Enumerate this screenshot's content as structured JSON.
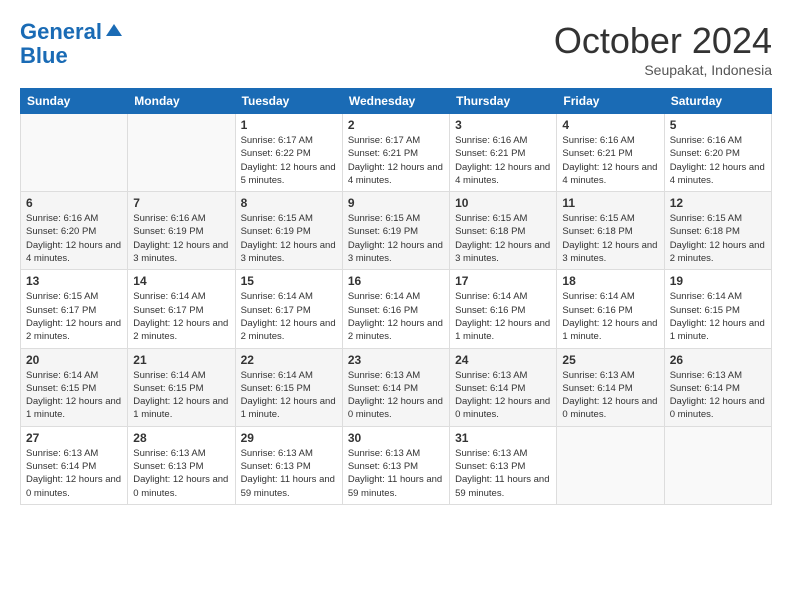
{
  "header": {
    "logo_line1": "General",
    "logo_line2": "Blue",
    "month_title": "October 2024",
    "subtitle": "Seupakat, Indonesia"
  },
  "weekdays": [
    "Sunday",
    "Monday",
    "Tuesday",
    "Wednesday",
    "Thursday",
    "Friday",
    "Saturday"
  ],
  "weeks": [
    [
      {
        "day": "",
        "sunrise": "",
        "sunset": "",
        "daylight": ""
      },
      {
        "day": "",
        "sunrise": "",
        "sunset": "",
        "daylight": ""
      },
      {
        "day": "1",
        "sunrise": "Sunrise: 6:17 AM",
        "sunset": "Sunset: 6:22 PM",
        "daylight": "Daylight: 12 hours and 5 minutes."
      },
      {
        "day": "2",
        "sunrise": "Sunrise: 6:17 AM",
        "sunset": "Sunset: 6:21 PM",
        "daylight": "Daylight: 12 hours and 4 minutes."
      },
      {
        "day": "3",
        "sunrise": "Sunrise: 6:16 AM",
        "sunset": "Sunset: 6:21 PM",
        "daylight": "Daylight: 12 hours and 4 minutes."
      },
      {
        "day": "4",
        "sunrise": "Sunrise: 6:16 AM",
        "sunset": "Sunset: 6:21 PM",
        "daylight": "Daylight: 12 hours and 4 minutes."
      },
      {
        "day": "5",
        "sunrise": "Sunrise: 6:16 AM",
        "sunset": "Sunset: 6:20 PM",
        "daylight": "Daylight: 12 hours and 4 minutes."
      }
    ],
    [
      {
        "day": "6",
        "sunrise": "Sunrise: 6:16 AM",
        "sunset": "Sunset: 6:20 PM",
        "daylight": "Daylight: 12 hours and 4 minutes."
      },
      {
        "day": "7",
        "sunrise": "Sunrise: 6:16 AM",
        "sunset": "Sunset: 6:19 PM",
        "daylight": "Daylight: 12 hours and 3 minutes."
      },
      {
        "day": "8",
        "sunrise": "Sunrise: 6:15 AM",
        "sunset": "Sunset: 6:19 PM",
        "daylight": "Daylight: 12 hours and 3 minutes."
      },
      {
        "day": "9",
        "sunrise": "Sunrise: 6:15 AM",
        "sunset": "Sunset: 6:19 PM",
        "daylight": "Daylight: 12 hours and 3 minutes."
      },
      {
        "day": "10",
        "sunrise": "Sunrise: 6:15 AM",
        "sunset": "Sunset: 6:18 PM",
        "daylight": "Daylight: 12 hours and 3 minutes."
      },
      {
        "day": "11",
        "sunrise": "Sunrise: 6:15 AM",
        "sunset": "Sunset: 6:18 PM",
        "daylight": "Daylight: 12 hours and 3 minutes."
      },
      {
        "day": "12",
        "sunrise": "Sunrise: 6:15 AM",
        "sunset": "Sunset: 6:18 PM",
        "daylight": "Daylight: 12 hours and 2 minutes."
      }
    ],
    [
      {
        "day": "13",
        "sunrise": "Sunrise: 6:15 AM",
        "sunset": "Sunset: 6:17 PM",
        "daylight": "Daylight: 12 hours and 2 minutes."
      },
      {
        "day": "14",
        "sunrise": "Sunrise: 6:14 AM",
        "sunset": "Sunset: 6:17 PM",
        "daylight": "Daylight: 12 hours and 2 minutes."
      },
      {
        "day": "15",
        "sunrise": "Sunrise: 6:14 AM",
        "sunset": "Sunset: 6:17 PM",
        "daylight": "Daylight: 12 hours and 2 minutes."
      },
      {
        "day": "16",
        "sunrise": "Sunrise: 6:14 AM",
        "sunset": "Sunset: 6:16 PM",
        "daylight": "Daylight: 12 hours and 2 minutes."
      },
      {
        "day": "17",
        "sunrise": "Sunrise: 6:14 AM",
        "sunset": "Sunset: 6:16 PM",
        "daylight": "Daylight: 12 hours and 1 minute."
      },
      {
        "day": "18",
        "sunrise": "Sunrise: 6:14 AM",
        "sunset": "Sunset: 6:16 PM",
        "daylight": "Daylight: 12 hours and 1 minute."
      },
      {
        "day": "19",
        "sunrise": "Sunrise: 6:14 AM",
        "sunset": "Sunset: 6:15 PM",
        "daylight": "Daylight: 12 hours and 1 minute."
      }
    ],
    [
      {
        "day": "20",
        "sunrise": "Sunrise: 6:14 AM",
        "sunset": "Sunset: 6:15 PM",
        "daylight": "Daylight: 12 hours and 1 minute."
      },
      {
        "day": "21",
        "sunrise": "Sunrise: 6:14 AM",
        "sunset": "Sunset: 6:15 PM",
        "daylight": "Daylight: 12 hours and 1 minute."
      },
      {
        "day": "22",
        "sunrise": "Sunrise: 6:14 AM",
        "sunset": "Sunset: 6:15 PM",
        "daylight": "Daylight: 12 hours and 1 minute."
      },
      {
        "day": "23",
        "sunrise": "Sunrise: 6:13 AM",
        "sunset": "Sunset: 6:14 PM",
        "daylight": "Daylight: 12 hours and 0 minutes."
      },
      {
        "day": "24",
        "sunrise": "Sunrise: 6:13 AM",
        "sunset": "Sunset: 6:14 PM",
        "daylight": "Daylight: 12 hours and 0 minutes."
      },
      {
        "day": "25",
        "sunrise": "Sunrise: 6:13 AM",
        "sunset": "Sunset: 6:14 PM",
        "daylight": "Daylight: 12 hours and 0 minutes."
      },
      {
        "day": "26",
        "sunrise": "Sunrise: 6:13 AM",
        "sunset": "Sunset: 6:14 PM",
        "daylight": "Daylight: 12 hours and 0 minutes."
      }
    ],
    [
      {
        "day": "27",
        "sunrise": "Sunrise: 6:13 AM",
        "sunset": "Sunset: 6:14 PM",
        "daylight": "Daylight: 12 hours and 0 minutes."
      },
      {
        "day": "28",
        "sunrise": "Sunrise: 6:13 AM",
        "sunset": "Sunset: 6:13 PM",
        "daylight": "Daylight: 12 hours and 0 minutes."
      },
      {
        "day": "29",
        "sunrise": "Sunrise: 6:13 AM",
        "sunset": "Sunset: 6:13 PM",
        "daylight": "Daylight: 11 hours and 59 minutes."
      },
      {
        "day": "30",
        "sunrise": "Sunrise: 6:13 AM",
        "sunset": "Sunset: 6:13 PM",
        "daylight": "Daylight: 11 hours and 59 minutes."
      },
      {
        "day": "31",
        "sunrise": "Sunrise: 6:13 AM",
        "sunset": "Sunset: 6:13 PM",
        "daylight": "Daylight: 11 hours and 59 minutes."
      },
      {
        "day": "",
        "sunrise": "",
        "sunset": "",
        "daylight": ""
      },
      {
        "day": "",
        "sunrise": "",
        "sunset": "",
        "daylight": ""
      }
    ]
  ]
}
